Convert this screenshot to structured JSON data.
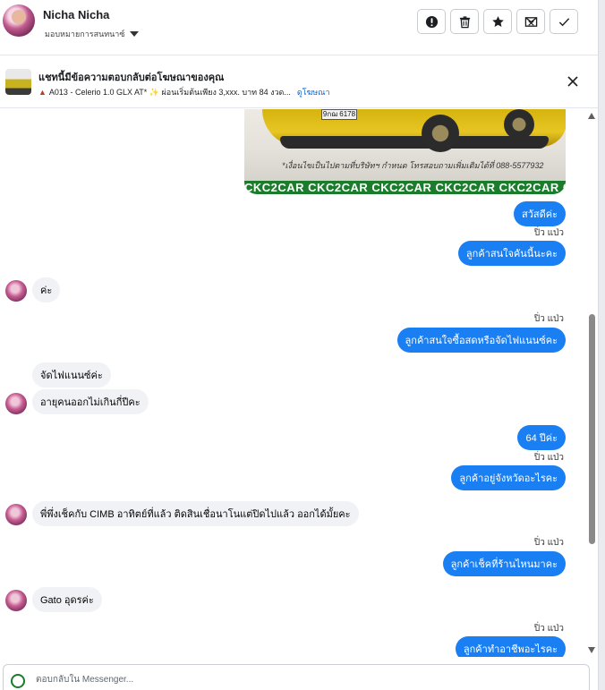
{
  "header": {
    "name": "Nicha Nicha",
    "assign_label": "มอบหมายการสนทนาซ์"
  },
  "ad": {
    "title": "แชทนี้มีข้อความตอบกลับต่อโฆษณาของคุณ",
    "subtitle": "A013 - Celerio 1.0 GLX AT* ✨ ผ่อนเริ่มต้นเพียง 3,xxx. บาท 84 งวด...",
    "link": "ดูโฆษณา"
  },
  "car_image": {
    "plate": "9กฌ 6178",
    "note": "*เงื่อนไขเป็นไปตามที่บริษัทฯ กำหนด โทรสอบถามเพิ่มเติมได้ที่ 088-5577932",
    "brand_strip": "CKC2CAR CKC2CAR CKC2CAR CKC2CAR CKC2CAR CKC2"
  },
  "messages": [
    {
      "text": "สวัสดีค่ะ"
    },
    {
      "sender": "ปิ่ว แป่ว",
      "text": "ลูกค้าสนใจคันนี้นะคะ"
    },
    {
      "text": "ค่ะ"
    },
    {
      "sender": "ปิ่ว แป่ว",
      "text": "ลูกค้าสนใจซื้อสดหรือจัดไฟแนนซ์คะ"
    },
    {
      "text": "จัดไฟแนนซ์ค่ะ"
    },
    {
      "text": "อายุคนออกไม่เกินกี่ปีคะ"
    },
    {
      "text": "64 ปีค่ะ"
    },
    {
      "sender": "ปิ่ว แป่ว",
      "text": "ลูกค้าอยู่จังหวัดอะไรคะ"
    },
    {
      "text": "พี่พึ่งเช็คกับ CIMB อาทิตย์ที่แล้ว ติดสินเชื่อนาโนแต่ปิดไปแล้ว ออกได้มั้ยคะ"
    },
    {
      "sender": "ปิ่ว แป่ว",
      "text": "ลูกค้าเช็คที่ร้านไหนมาคะ"
    },
    {
      "text": "Gato อุดรค่ะ"
    },
    {
      "sender": "ปิ่ว แป่ว",
      "text": "ลูกค้าทำอาชีพอะไรคะ"
    }
  ],
  "composer": {
    "placeholder": "ตอบกลับใน Messenger..."
  },
  "icons": {
    "mark_important": "exclamation-circle-icon",
    "delete": "trash-icon",
    "star": "star-icon",
    "unread": "mail-x-icon",
    "done": "check-icon",
    "close": "close-icon"
  }
}
